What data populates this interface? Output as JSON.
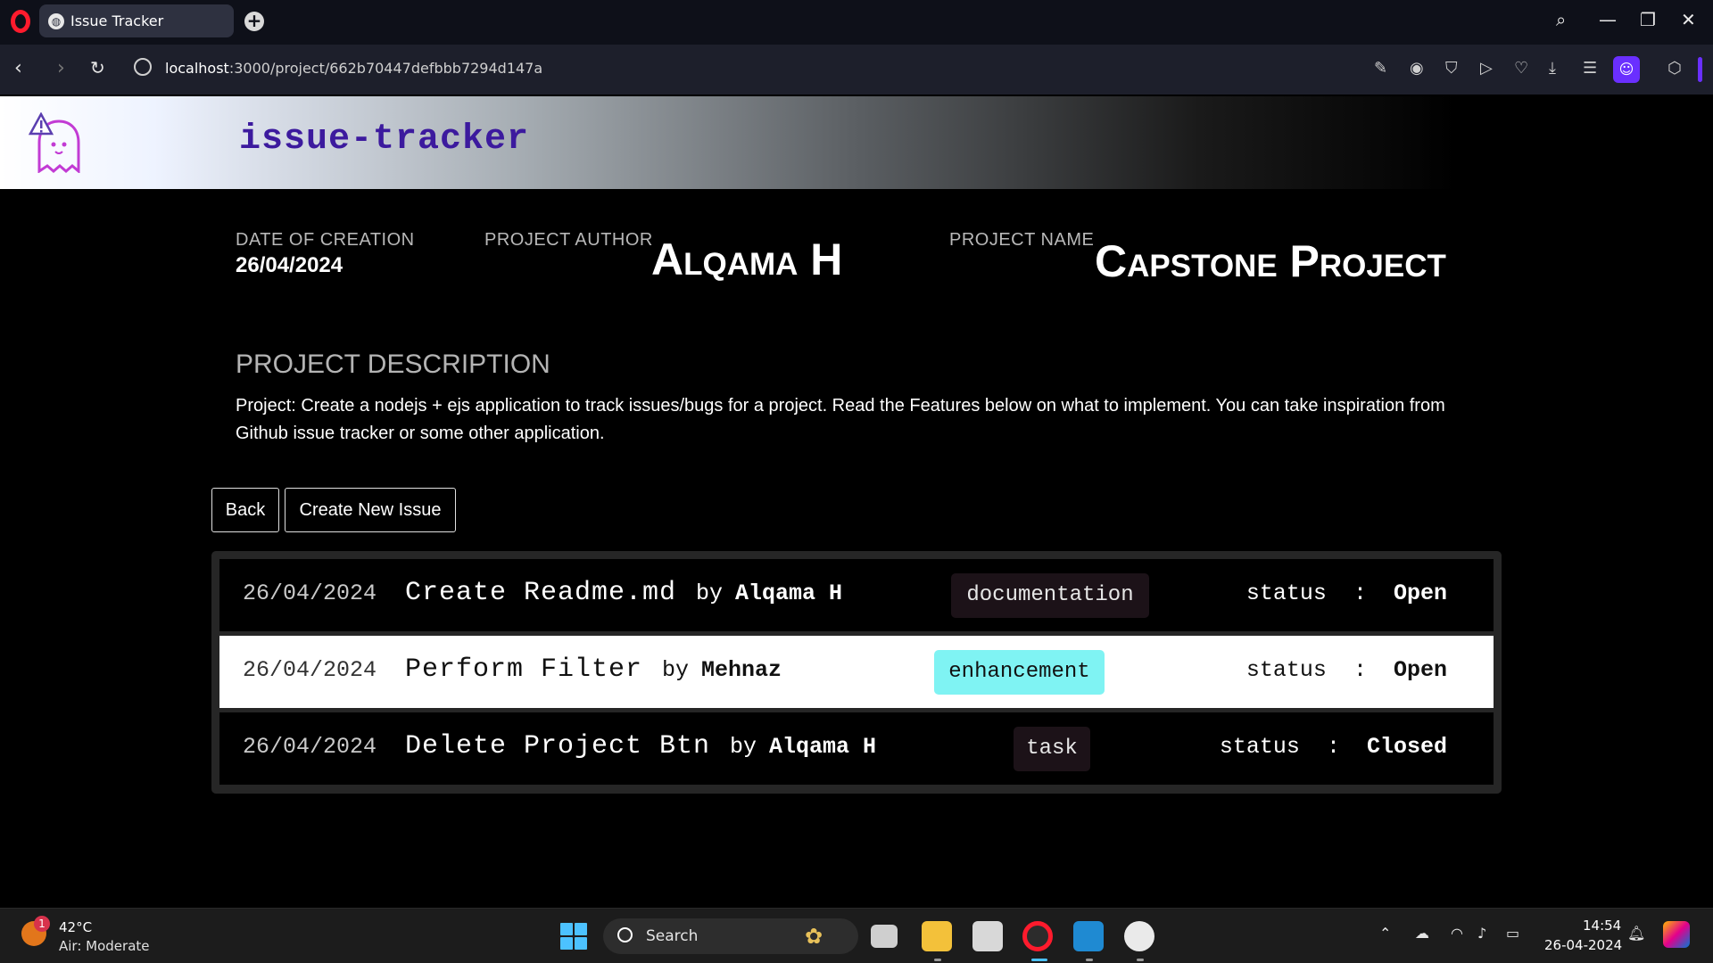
{
  "browser": {
    "tab_title": "Issue Tracker",
    "url_host": "localhost",
    "url_path": ":3000/project/662b70447defbbb7294d147a"
  },
  "header": {
    "app_title": "issue-tracker"
  },
  "project": {
    "date_label": "DATE OF CREATION",
    "date_value": "26/04/2024",
    "author_label": "PROJECT AUTHOR",
    "author_value": "Alqama H",
    "name_label": "PROJECT NAME",
    "name_value": "Capstone Project",
    "description_title": "PROJECT DESCRIPTION",
    "description_text": "Project: Create a nodejs + ejs application to track issues/bugs for a project. Read the Features below on what to implement. You can take inspiration from Github issue tracker or some other application."
  },
  "actions": {
    "back_label": "Back",
    "create_label": "Create New Issue"
  },
  "issues": [
    {
      "date": "26/04/2024",
      "title": "Create Readme.md",
      "by": "by",
      "author": "Alqama H",
      "label": "documentation",
      "label_color": "#1c1218",
      "status_word": "status",
      "sep": ":",
      "status": "Open"
    },
    {
      "date": "26/04/2024",
      "title": "Perform Filter",
      "by": "by",
      "author": "Mehnaz",
      "label": "enhancement",
      "label_color": "#7ff3f3",
      "status_word": "status",
      "sep": ":",
      "status": "Open"
    },
    {
      "date": "26/04/2024",
      "title": "Delete Project Btn",
      "by": "by",
      "author": "Alqama H",
      "label": "task",
      "label_color": "#1c1218",
      "status_word": "status",
      "sep": ":",
      "status": "Closed"
    }
  ],
  "taskbar": {
    "weather_temp": "42°C",
    "weather_desc": "Air: Moderate",
    "weather_badge": "1",
    "search_placeholder": "Search",
    "time": "14:54",
    "date": "26-04-2024"
  },
  "colors": {
    "brand_title": "#3c1a9e",
    "opera_red": "#ff1b2d",
    "profile_purple": "#6a2fff"
  }
}
